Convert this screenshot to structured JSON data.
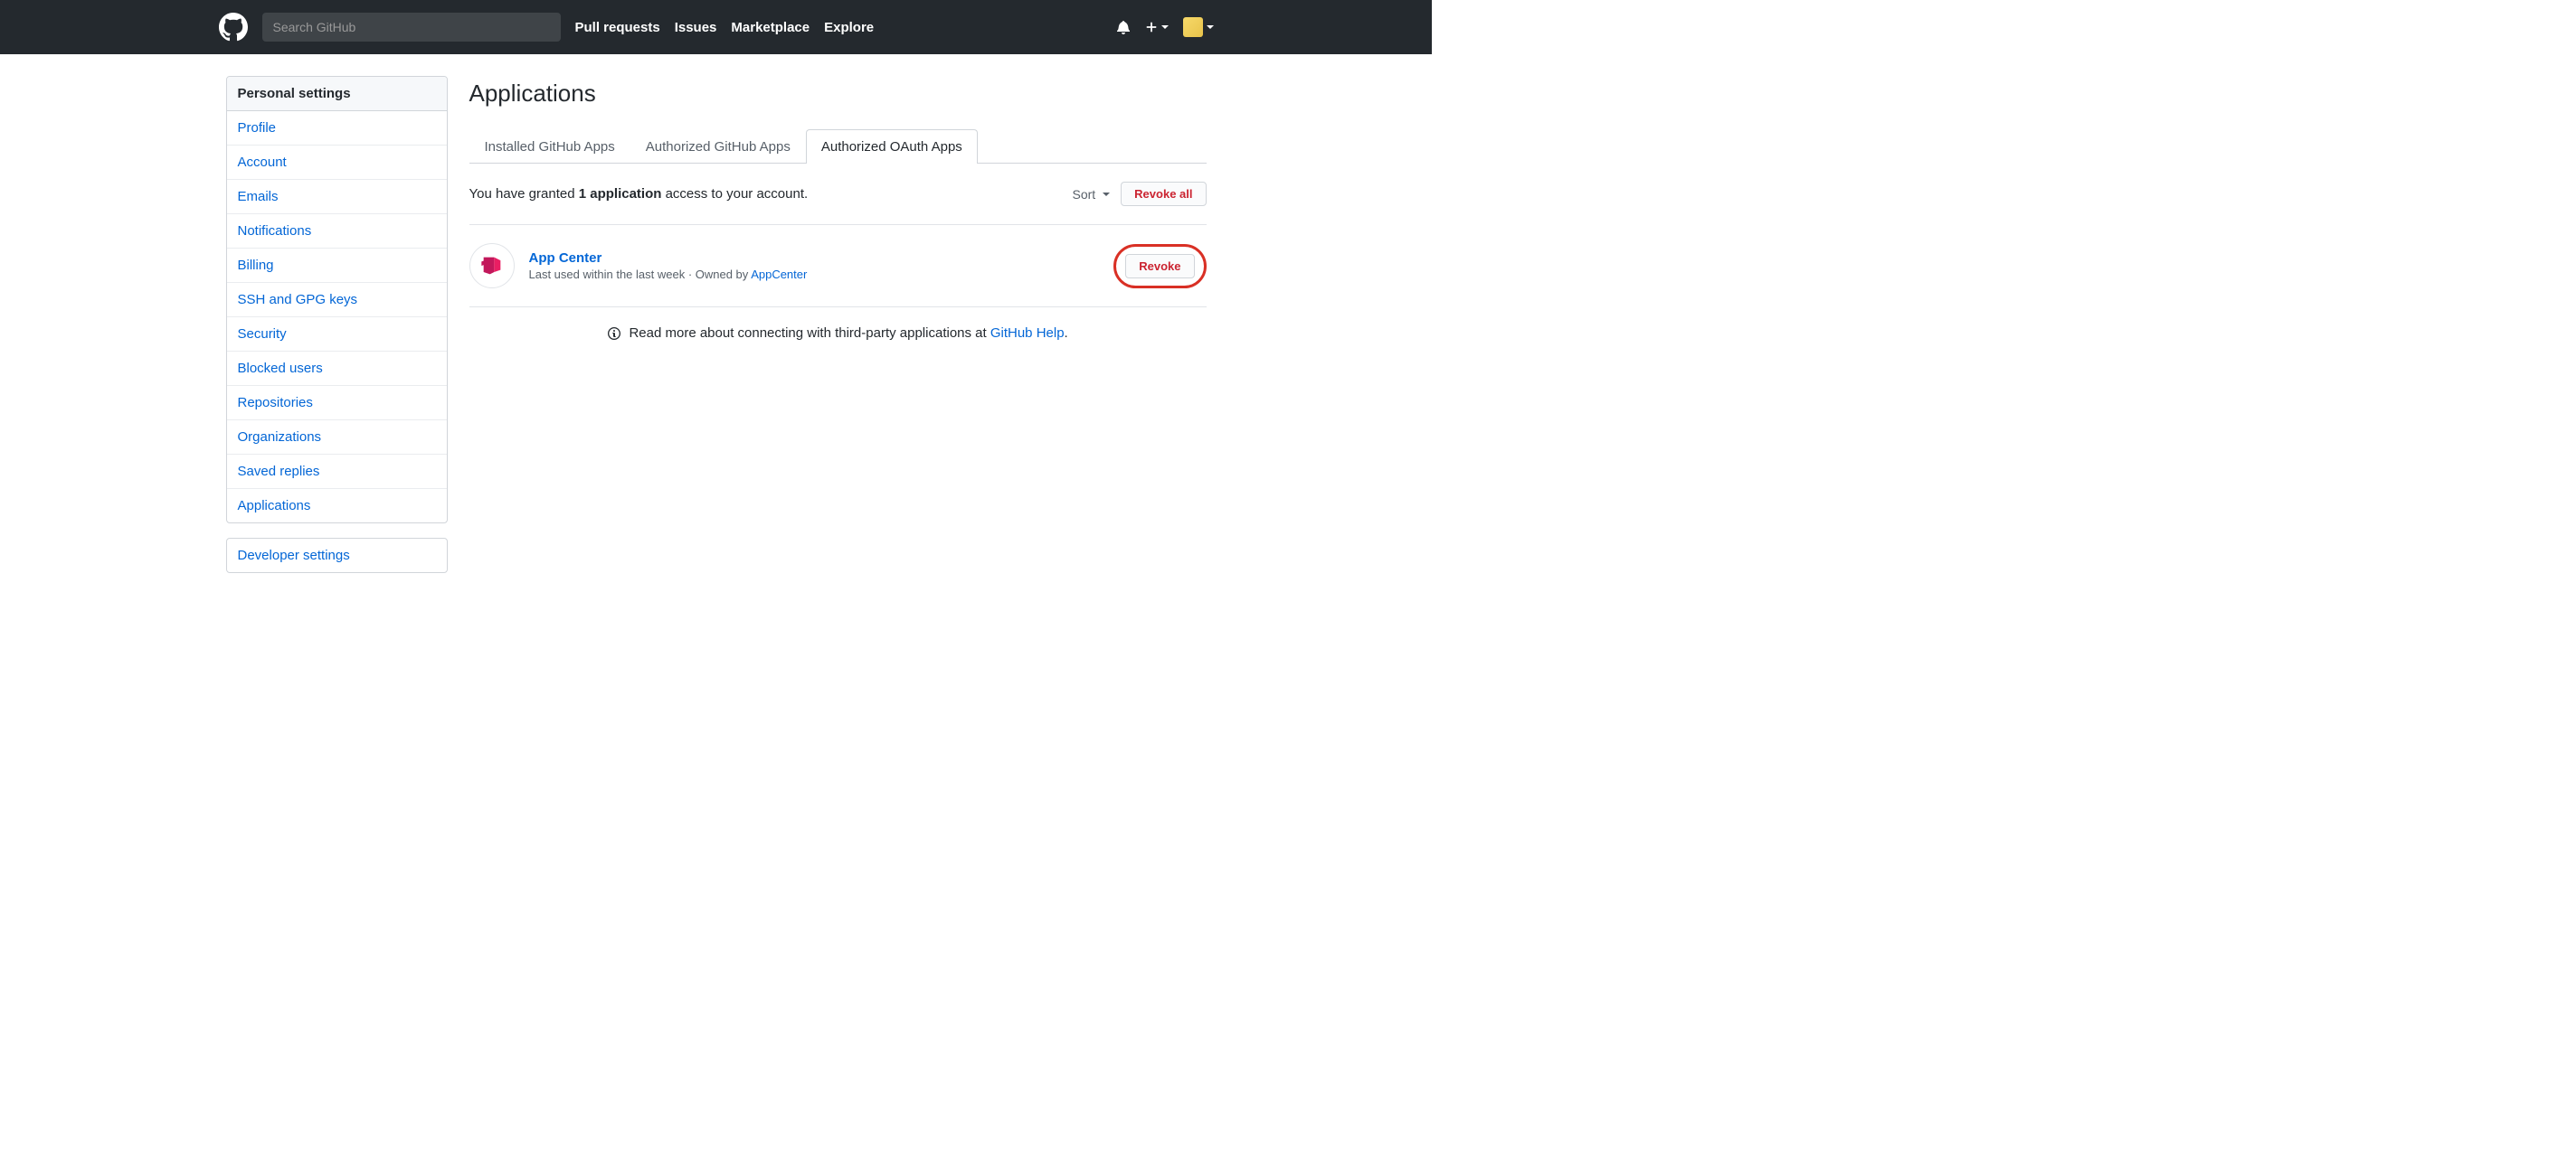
{
  "header": {
    "search_placeholder": "Search GitHub",
    "nav": {
      "pull_requests": "Pull requests",
      "issues": "Issues",
      "marketplace": "Marketplace",
      "explore": "Explore"
    }
  },
  "sidebar": {
    "heading": "Personal settings",
    "items": [
      "Profile",
      "Account",
      "Emails",
      "Notifications",
      "Billing",
      "SSH and GPG keys",
      "Security",
      "Blocked users",
      "Repositories",
      "Organizations",
      "Saved replies",
      "Applications"
    ],
    "developer": "Developer settings"
  },
  "main": {
    "title": "Applications",
    "tabs": {
      "installed": "Installed GitHub Apps",
      "authorized_apps": "Authorized GitHub Apps",
      "authorized_oauth": "Authorized OAuth Apps"
    },
    "grant_prefix": "You have granted ",
    "grant_count": "1 application",
    "grant_suffix": " access to your account.",
    "sort_label": "Sort",
    "revoke_all": "Revoke all",
    "app": {
      "name": "App Center",
      "meta_prefix": "Last used within the last week · Owned by ",
      "owner": "AppCenter",
      "revoke": "Revoke"
    },
    "footer_text": "Read more about connecting with third-party applications at ",
    "footer_link": "GitHub Help",
    "footer_period": "."
  }
}
